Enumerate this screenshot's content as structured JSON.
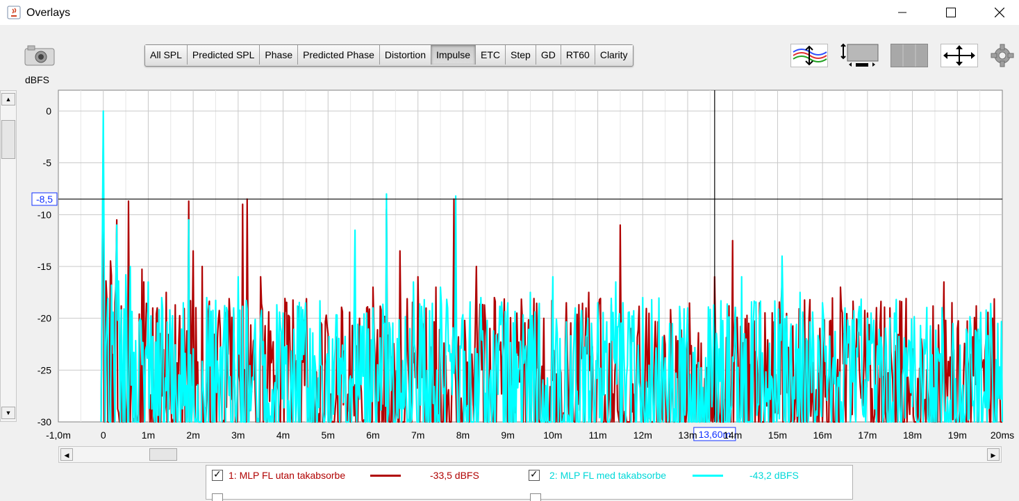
{
  "window": {
    "title": "Overlays"
  },
  "toolbar": {
    "tabs": [
      "All SPL",
      "Predicted SPL",
      "Phase",
      "Predicted Phase",
      "Distortion",
      "Impulse",
      "ETC",
      "Step",
      "GD",
      "RT60",
      "Clarity"
    ],
    "active_tab": "Impulse"
  },
  "icons": [
    "camera-icon",
    "trace-arrange-icon",
    "graph-size-icon",
    "controls-panel-icon",
    "axis-limits-icon",
    "settings-gear-icon"
  ],
  "cursor": {
    "y_readout": "-8,5",
    "x_readout": "13,60m"
  },
  "chart_data": {
    "type": "line",
    "ylabel": "dBFS",
    "xlabel": "",
    "x_unit": "ms",
    "xlim": [
      -1.0,
      20
    ],
    "ylim": [
      -30,
      0
    ],
    "x_tick_labels": [
      "-1,0m",
      "0",
      "1m",
      "2m",
      "3m",
      "4m",
      "5m",
      "6m",
      "7m",
      "8m",
      "9m",
      "10m",
      "11m",
      "12m",
      "13m",
      "14m",
      "15m",
      "16m",
      "17m",
      "18m",
      "19m",
      "20ms"
    ],
    "y_tick_labels": [
      "0",
      "-5",
      "-10",
      "-15",
      "-20",
      "-25",
      "-30"
    ],
    "grid": true,
    "cursor_x": 13.6,
    "cursor_y": -8.5,
    "series": [
      {
        "name": "1: MLP FL utan takabsorber",
        "color": "#b00000",
        "peaks": [
          [
            0.0,
            -2.5
          ],
          [
            0.3,
            -10.5
          ],
          [
            0.57,
            -8.7
          ],
          [
            0.9,
            -16.5
          ],
          [
            1.2,
            -19.0
          ],
          [
            1.4,
            -17.5
          ],
          [
            1.9,
            -8.7
          ],
          [
            2.0,
            -13.5
          ],
          [
            2.2,
            -15.0
          ],
          [
            2.6,
            -21.0
          ],
          [
            3.1,
            -9.0
          ],
          [
            3.2,
            -8.5
          ],
          [
            3.5,
            -16.0
          ],
          [
            4.0,
            -19.5
          ],
          [
            4.5,
            -20.0
          ],
          [
            5.0,
            -21.5
          ],
          [
            5.7,
            -20.0
          ],
          [
            6.0,
            -17.0
          ],
          [
            6.3,
            -9.5
          ],
          [
            6.6,
            -13.5
          ],
          [
            7.0,
            -16.0
          ],
          [
            7.4,
            -17.0
          ],
          [
            7.8,
            -8.5
          ],
          [
            8.3,
            -15.0
          ],
          [
            8.7,
            -18.0
          ],
          [
            9.2,
            -19.5
          ],
          [
            9.8,
            -20.0
          ],
          [
            10.3,
            -18.5
          ],
          [
            10.8,
            -17.5
          ],
          [
            11.5,
            -11.0
          ],
          [
            12.0,
            -21.0
          ],
          [
            12.5,
            -22.5
          ],
          [
            13.0,
            -20.5
          ],
          [
            13.6,
            -16.0
          ],
          [
            14.0,
            -12.5
          ],
          [
            14.6,
            -18.5
          ],
          [
            15.1,
            -16.5
          ],
          [
            15.7,
            -20.0
          ],
          [
            16.4,
            -17.0
          ],
          [
            17.0,
            -19.5
          ],
          [
            17.5,
            -19.0
          ],
          [
            18.2,
            -22.0
          ],
          [
            18.7,
            -16.5
          ],
          [
            19.0,
            -21.0
          ],
          [
            19.5,
            -23.0
          ]
        ]
      },
      {
        "name": "2: MLP FL med takabsorber",
        "color": "#00ffff",
        "peaks": [
          [
            0.0,
            0.0
          ],
          [
            0.3,
            -11.0
          ],
          [
            0.6,
            -15.0
          ],
          [
            1.0,
            -16.5
          ],
          [
            1.3,
            -18.0
          ],
          [
            1.9,
            -10.5
          ],
          [
            2.3,
            -18.0
          ],
          [
            2.9,
            -19.0
          ],
          [
            3.0,
            -16.0
          ],
          [
            3.5,
            -20.0
          ],
          [
            4.0,
            -19.5
          ],
          [
            4.6,
            -21.0
          ],
          [
            5.1,
            -22.0
          ],
          [
            5.6,
            -11.5
          ],
          [
            6.0,
            -19.0
          ],
          [
            6.3,
            -8.0
          ],
          [
            6.9,
            -16.5
          ],
          [
            7.5,
            -17.0
          ],
          [
            7.85,
            -8.2
          ],
          [
            8.4,
            -18.0
          ],
          [
            9.0,
            -18.5
          ],
          [
            9.5,
            -17.5
          ],
          [
            10.0,
            -16.0
          ],
          [
            10.5,
            -19.0
          ],
          [
            11.0,
            -18.5
          ],
          [
            11.4,
            -16.5
          ],
          [
            12.0,
            -18.0
          ],
          [
            12.6,
            -20.5
          ],
          [
            13.0,
            -19.0
          ],
          [
            13.6,
            -21.0
          ],
          [
            14.2,
            -16.0
          ],
          [
            14.6,
            -20.0
          ],
          [
            15.1,
            -14.0
          ],
          [
            15.5,
            -17.5
          ],
          [
            16.0,
            -18.5
          ],
          [
            16.5,
            -19.0
          ],
          [
            17.0,
            -20.0
          ],
          [
            17.6,
            -19.5
          ],
          [
            18.3,
            -22.5
          ],
          [
            18.9,
            -20.5
          ],
          [
            19.3,
            -21.0
          ],
          [
            19.9,
            -20.5
          ]
        ]
      }
    ]
  },
  "legend": {
    "items": [
      {
        "label": "1: MLP FL utan takabsorbe",
        "value": "-33,5 dBFS",
        "color": "#b00000",
        "checked": true
      },
      {
        "label": "2: MLP FL med takabsorbe",
        "value": "-43,2 dBFS",
        "color": "#00e0e0",
        "checked": true
      }
    ]
  }
}
